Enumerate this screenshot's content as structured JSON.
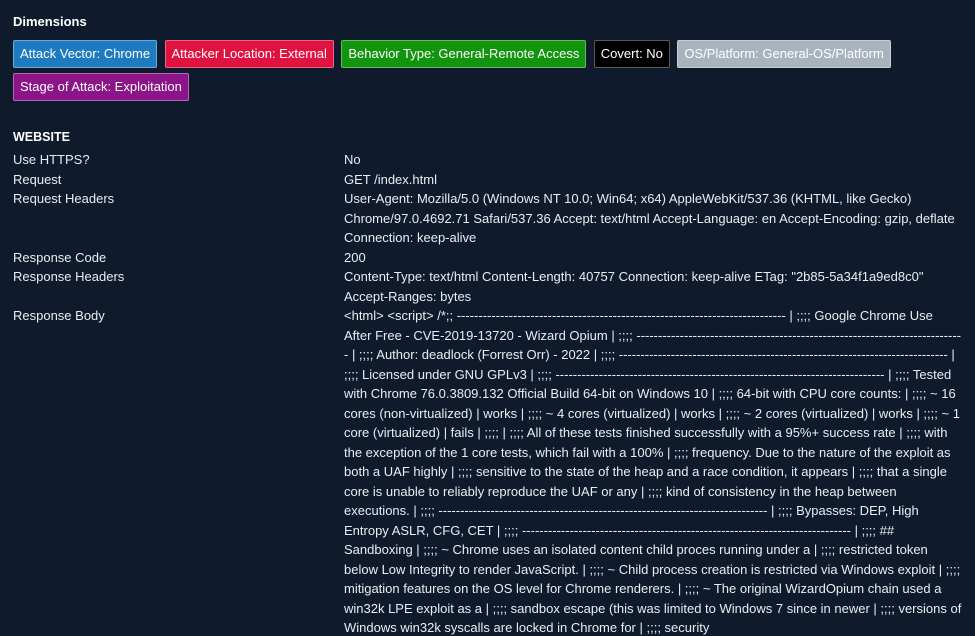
{
  "dimensions": {
    "title": "Dimensions",
    "badges": [
      {
        "label": "Attack Vector: Chrome",
        "bg": "#1f7bbf",
        "fg": "#ffffff"
      },
      {
        "label": "Attacker Location: External",
        "bg": "#e0123f",
        "fg": "#ffffff"
      },
      {
        "label": "Behavior Type: General-Remote Access",
        "bg": "#12940e",
        "fg": "#ffffff"
      },
      {
        "label": "Covert: No",
        "bg": "#000000",
        "fg": "#ffffff"
      },
      {
        "label": "OS/Platform: General-OS/Platform",
        "bg": "#a9b3bd",
        "fg": "#ffffff"
      },
      {
        "label": "Stage of Attack: Exploitation",
        "bg": "#8b1488",
        "fg": "#ffffff"
      }
    ]
  },
  "website": {
    "title": "WEBSITE",
    "rows": [
      {
        "label": "Use HTTPS?",
        "value": "No"
      },
      {
        "label": "Request",
        "value": "GET /index.html"
      },
      {
        "label": "Request Headers",
        "value": "User-Agent: Mozilla/5.0 (Windows NT 10.0; Win64; x64) AppleWebKit/537.36 (KHTML, like Gecko) Chrome/97.0.4692.71 Safari/537.36 Accept: text/html Accept-Language: en Accept-Encoding: gzip, deflate Connection: keep-alive"
      },
      {
        "label": "Response Code",
        "value": "200"
      },
      {
        "label": "Response Headers",
        "value": "Content-Type: text/html Content-Length: 40757 Connection: keep-alive ETag: \"2b85-5a34f1a9ed8c0\" Accept-Ranges: bytes"
      },
      {
        "label": "Response Body",
        "value": "<html> <script> /*;; ---------------------------------------------------------------------------- | ;;;; Google Chrome Use After Free - CVE-2019-13720 - Wizard Opium | ;;;; ---------------------------------------------------------------------------- | ;;;; Author: deadlock (Forrest Orr) - 2022 | ;;;; ---------------------------------------------------------------------------- | ;;;; Licensed under GNU GPLv3 | ;;;; ---------------------------------------------------------------------------- | ;;;; Tested with Chrome 76.0.3809.132 Official Build 64-bit on Windows 10 | ;;;; 64-bit with CPU core counts: | ;;;; ~ 16 cores (non-virtualized) | works | ;;;; ~ 4 cores (virtualized) | works | ;;;; ~ 2 cores (virtualized) | works | ;;;; ~ 1 core (virtualized) | fails | ;;;; | ;;;; All of these tests finished successfully with a 95%+ success rate | ;;;; with the exception of the 1 core tests, which fail with a 100% | ;;;; frequency. Due to the nature of the exploit as both a UAF highly | ;;;; sensitive to the state of the heap and a race condition, it appears | ;;;; that a single core is unable to reliably reproduce the UAF or any | ;;;; kind of consistency in the heap between executions. | ;;;; ---------------------------------------------------------------------------- | ;;;; Bypasses: DEP, High Entropy ASLR, CFG, CET | ;;;; ---------------------------------------------------------------------------- | ;;;; ## Sandboxing | ;;;; ~ Chrome uses an isolated content child proces running under a | ;;;; restricted token below Low Integrity to render JavaScript. | ;;;; ~ Child process creation is restricted via Windows exploit | ;;;; mitigation features on the OS level for Chrome renderers. | ;;;; ~ The original WizardOpium chain used a win32k LPE exploit as a | ;;;; sandbox escape (this was limited to Windows 7 since in newer | ;;;; versions of Windows win32k syscalls are locked in Chrome for | ;;;; security"
      }
    ]
  }
}
